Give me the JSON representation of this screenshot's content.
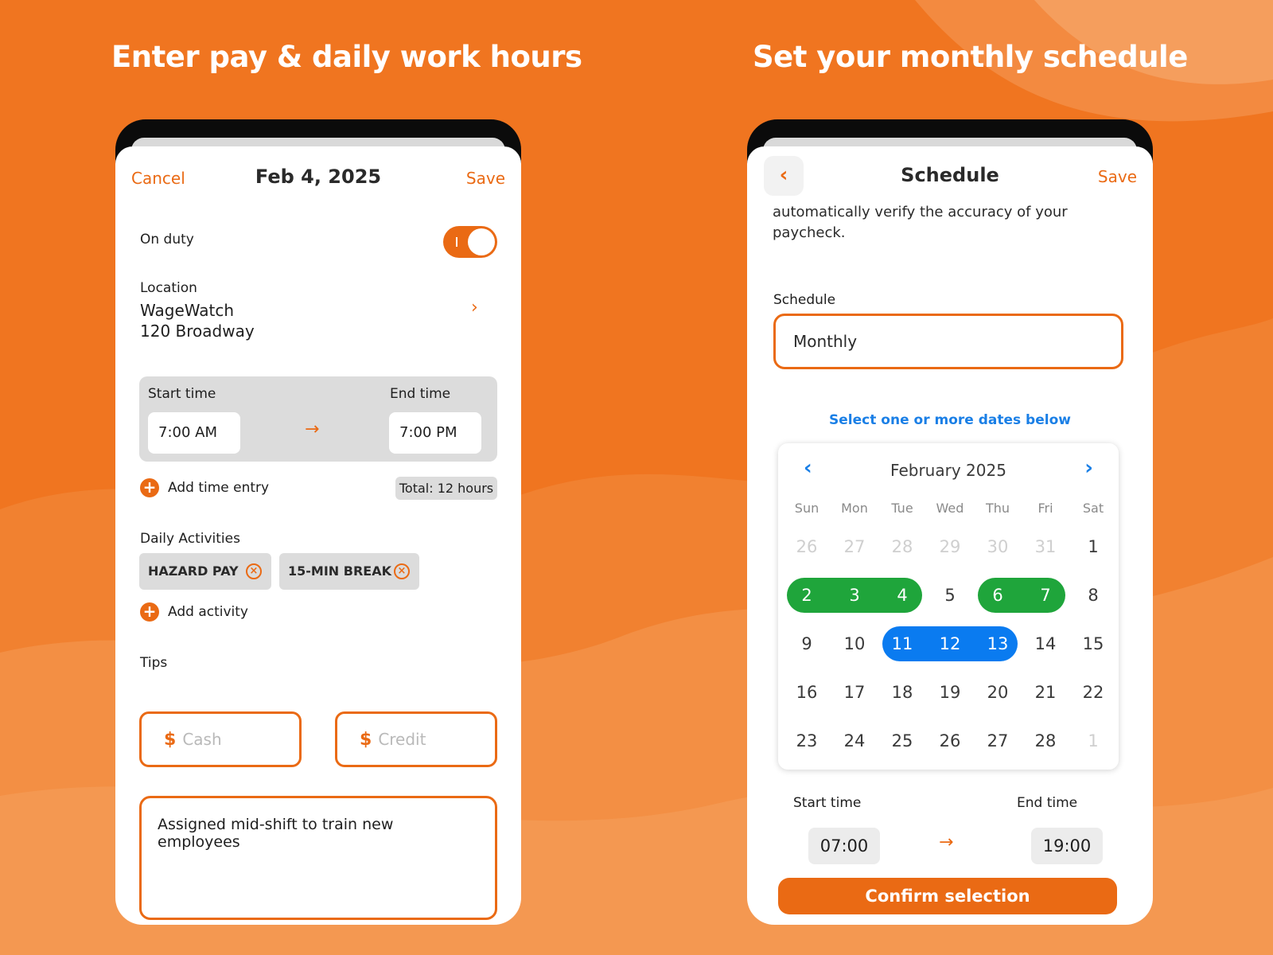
{
  "colors": {
    "background": "#f07520",
    "accent": "#ea6a14",
    "link_blue": "#1a7fe6",
    "green_selection": "#1fa53b",
    "blue_selection": "#0a7bf0"
  },
  "left_panel": {
    "headline": "Enter pay & daily work hours",
    "nav": {
      "cancel": "Cancel",
      "title": "Feb 4, 2025",
      "save": "Save"
    },
    "on_duty": {
      "label": "On duty",
      "state": "on"
    },
    "location": {
      "label": "Location",
      "name": "WageWatch",
      "address": "120 Broadway",
      "icon": "chevron-right-icon"
    },
    "time": {
      "start_label": "Start time",
      "start_value": "7:00 AM",
      "end_label": "End time",
      "end_value": "7:00 PM",
      "arrow_icon": "arrow-right-icon"
    },
    "add_time_entry": "Add time entry",
    "total": "Total: 12 hours",
    "activities": {
      "label": "Daily Activities",
      "chips": [
        "HAZARD PAY",
        "15-MIN BREAK"
      ],
      "add": "Add activity"
    },
    "tips": {
      "label": "Tips",
      "cash_placeholder": "Cash",
      "credit_placeholder": "Credit",
      "currency": "$"
    },
    "notes": "Assigned mid-shift to train new employees"
  },
  "right_panel": {
    "headline": "Set your monthly schedule",
    "nav": {
      "title": "Schedule",
      "save": "Save",
      "back_icon": "chevron-left-icon"
    },
    "intro": "automatically verify the accuracy of your paycheck.",
    "schedule": {
      "label": "Schedule",
      "value": "Monthly"
    },
    "hint": "Select one or more dates below",
    "calendar": {
      "month": "February 2025",
      "weekdays": [
        "Sun",
        "Mon",
        "Tue",
        "Wed",
        "Thu",
        "Fri",
        "Sat"
      ],
      "weeks": [
        [
          "26",
          "27",
          "28",
          "29",
          "30",
          "31",
          "1"
        ],
        [
          "2",
          "3",
          "4",
          "5",
          "6",
          "7",
          "8"
        ],
        [
          "9",
          "10",
          "11",
          "12",
          "13",
          "14",
          "15"
        ],
        [
          "16",
          "17",
          "18",
          "19",
          "20",
          "21",
          "22"
        ],
        [
          "23",
          "24",
          "25",
          "26",
          "27",
          "28",
          "1"
        ]
      ],
      "muted": [
        [
          0,
          0
        ],
        [
          0,
          1
        ],
        [
          0,
          2
        ],
        [
          0,
          3
        ],
        [
          0,
          4
        ],
        [
          0,
          5
        ],
        [
          4,
          6
        ]
      ],
      "green_selected": [
        "2",
        "3",
        "4",
        "6",
        "7"
      ],
      "blue_selected": [
        "11",
        "12",
        "13"
      ]
    },
    "time": {
      "start_label": "Start time",
      "start_value": "07:00",
      "end_label": "End time",
      "end_value": "19:00"
    },
    "confirm": "Confirm selection"
  }
}
